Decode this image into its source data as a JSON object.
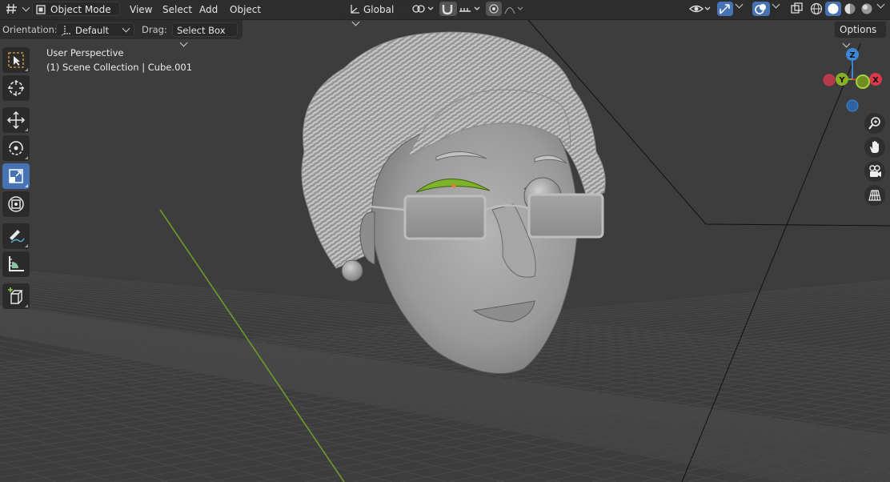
{
  "header": {
    "editor_type_icon": "grid-hash-icon",
    "mode": "Object Mode",
    "menus": [
      "View",
      "Select",
      "Add",
      "Object"
    ],
    "transform_orientation": "Global"
  },
  "tool_settings": {
    "orientation_label": "Orientation:",
    "orientation_value": "Default",
    "drag_label": "Drag:",
    "drag_value": "Select Box",
    "options_label": "Options"
  },
  "viewport": {
    "perspective": "User Perspective",
    "collection": "(1) Scene Collection | Cube.001",
    "gizmo_axes": {
      "z": "Z",
      "y": "Y",
      "x": "X"
    }
  },
  "tools": [
    "select-box",
    "cursor",
    "move",
    "rotate",
    "scale",
    "transform",
    "annotate",
    "measure",
    "add-cube"
  ],
  "active_tool": "scale",
  "colors": {
    "accent": "#4772b3",
    "header_bg": "#2d2d2d",
    "viewport_bg": "#3d3d3d",
    "axis_x": "#d9394c",
    "axis_y": "#87b026",
    "axis_z": "#3d88d6"
  }
}
